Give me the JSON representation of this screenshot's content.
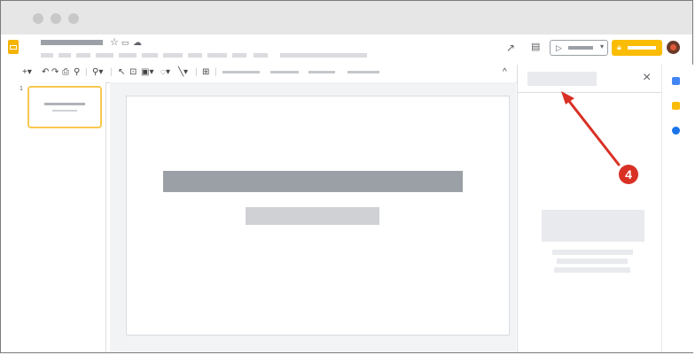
{
  "colors": {
    "accent": "#fbbc04",
    "badge": "#d93025",
    "slide_bar_dark": "#9aa0a6",
    "slide_bar_light": "#cfd1d4"
  },
  "header": {
    "star_icon": "star-icon",
    "move_icon": "folder-icon",
    "cloud_icon": "cloud-icon"
  },
  "toolbar": {
    "collapse_icon": "chevron-up-icon"
  },
  "filmstrip": {
    "slide_number": "1"
  },
  "panel": {
    "close_label": "×"
  },
  "annotation": {
    "step_number": "4"
  }
}
